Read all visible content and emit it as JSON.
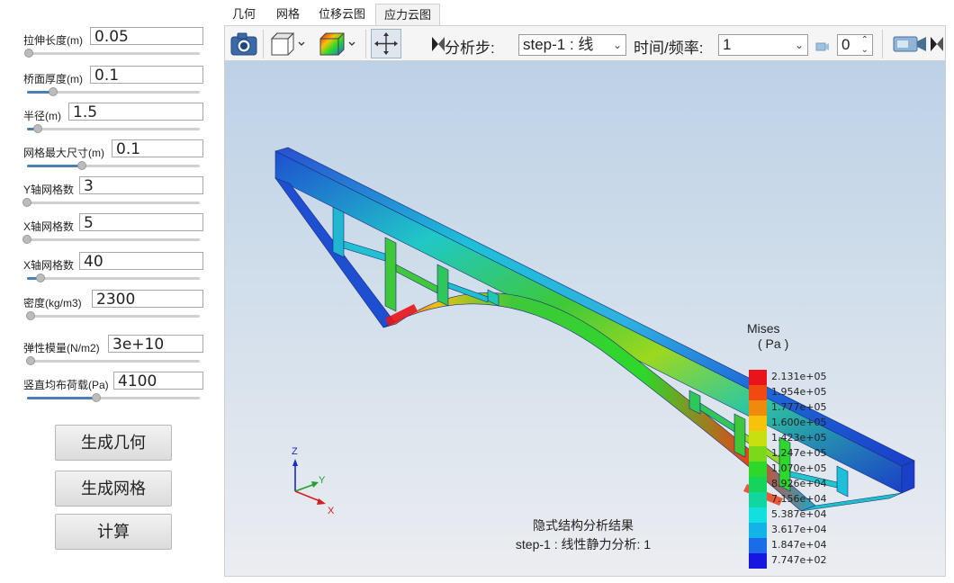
{
  "params": [
    {
      "label": "拉伸长度(m)",
      "value": "0.05",
      "slider": 0.01
    },
    {
      "label": "桥面厚度(m)",
      "value": "0.1",
      "slider": 0.15
    },
    {
      "label": "半径(m)",
      "value": "1.5",
      "slider": 0.06
    },
    {
      "label": "网格最大尺寸(m)",
      "value": "0.1",
      "slider": 0.32
    },
    {
      "label": "Y轴网格数",
      "value": "3",
      "slider": 0.0
    },
    {
      "label": "X轴网格数",
      "value": "5",
      "slider": 0.0
    },
    {
      "label": "X轴网格数",
      "value": "40",
      "slider": 0.08
    },
    {
      "label": "密度(kg/m3)",
      "value": "2300",
      "slider": 0.02
    },
    {
      "label": "弹性模量(N/m2)",
      "value": "3e+10",
      "slider": 0.02
    },
    {
      "label": "竖直均布荷载(Pa)",
      "value": "4100",
      "slider": 0.4
    }
  ],
  "buttons": {
    "generate_geometry": "生成几何",
    "generate_mesh": "生成网格",
    "compute": "计算"
  },
  "tabs": [
    {
      "label": "几何",
      "active": false
    },
    {
      "label": "网格",
      "active": false
    },
    {
      "label": "位移云图",
      "active": false
    },
    {
      "label": "应力云图",
      "active": true
    }
  ],
  "toolbar": {
    "step_label": "分析步:",
    "step_value": "step-1 : 线",
    "time_label": "时间/频率:",
    "time_value": "1",
    "frame_value": "0"
  },
  "legend": {
    "title": "Mises",
    "unit": "( Pa )",
    "entries": [
      {
        "value": "2.131e+05",
        "color": "#e8141a"
      },
      {
        "value": "1.954e+05",
        "color": "#f04a10"
      },
      {
        "value": "1.777e+05",
        "color": "#f08a0c"
      },
      {
        "value": "1.600e+05",
        "color": "#f5c40a"
      },
      {
        "value": "1.423e+05",
        "color": "#c8e010"
      },
      {
        "value": "1.247e+05",
        "color": "#7cd81a"
      },
      {
        "value": "1.070e+05",
        "color": "#2ed82a"
      },
      {
        "value": "8.926e+04",
        "color": "#14d45c"
      },
      {
        "value": "7.156e+04",
        "color": "#12d69e"
      },
      {
        "value": "5.387e+04",
        "color": "#10e0e0"
      },
      {
        "value": "3.617e+04",
        "color": "#12b4e8"
      },
      {
        "value": "1.847e+04",
        "color": "#1a6ce8"
      },
      {
        "value": "7.747e+02",
        "color": "#1616e0"
      }
    ]
  },
  "axes": {
    "x": "X",
    "y": "Y",
    "z": "Z"
  },
  "caption": {
    "line1": "隐式结构分析结果",
    "line2": "step-1 : 线性静力分析: 1"
  },
  "colors": {
    "accent": "#4a7fb8",
    "stress_low": "#1a3fc8",
    "stress_mid": "#2ec830",
    "stress_high": "#e8141a"
  }
}
